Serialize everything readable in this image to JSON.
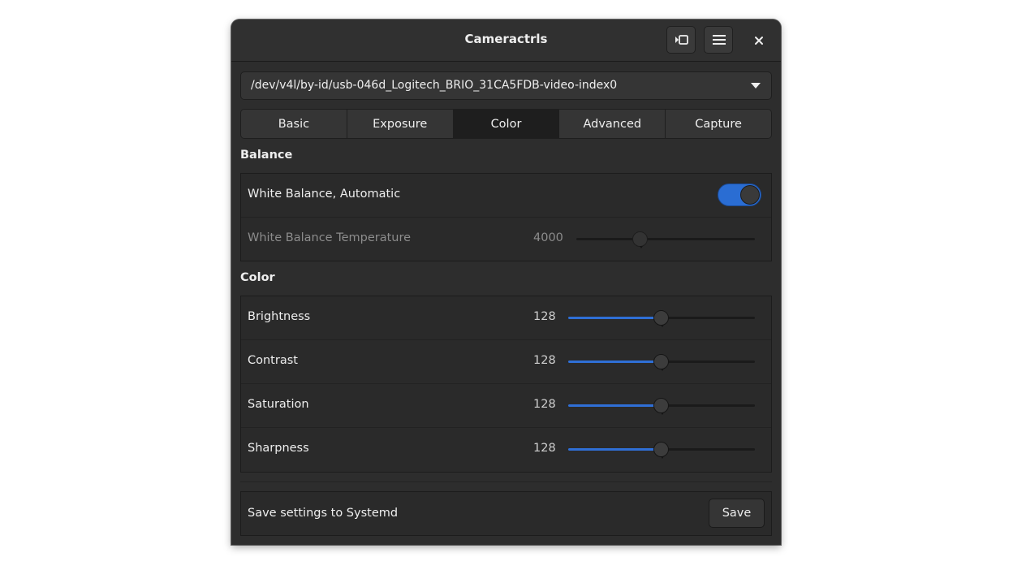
{
  "window": {
    "title": "Cameractrls",
    "header_buttons": [
      {
        "name": "camera-preview-button",
        "icon": "camera-preview-icon"
      },
      {
        "name": "menu-button",
        "icon": "hamburger-menu-icon"
      },
      {
        "name": "close-button",
        "icon": "close-icon"
      }
    ]
  },
  "device_selector": {
    "value": "/dev/v4l/by-id/usb-046d_Logitech_BRIO_31CA5FDB-video-index0",
    "icon": "dropdown-arrow-icon"
  },
  "tabs": [
    {
      "label": "Basic",
      "active": false
    },
    {
      "label": "Exposure",
      "active": false
    },
    {
      "label": "Color",
      "active": true
    },
    {
      "label": "Advanced",
      "active": false
    },
    {
      "label": "Capture",
      "active": false
    }
  ],
  "balance": {
    "title": "Balance",
    "auto": {
      "label": "White Balance, Automatic",
      "enabled": true
    },
    "temperature": {
      "label": "White Balance Temperature",
      "value": "4000",
      "level": 0.36,
      "sensitive": false
    }
  },
  "color": {
    "title": "Color",
    "controls": [
      {
        "label": "Brightness",
        "value": "128",
        "level": 0.5
      },
      {
        "label": "Contrast",
        "value": "128",
        "level": 0.5
      },
      {
        "label": "Saturation",
        "value": "128",
        "level": 0.5
      },
      {
        "label": "Sharpness",
        "value": "128",
        "level": 0.5
      }
    ]
  },
  "systemd": {
    "label": "Save settings to Systemd",
    "button_label": "Save"
  },
  "colors": {
    "accent": "#2f6fd6",
    "window_bg": "#2d2d2d",
    "panel_bg": "#2a2a2a",
    "active_tab": "#1e1e1e"
  }
}
